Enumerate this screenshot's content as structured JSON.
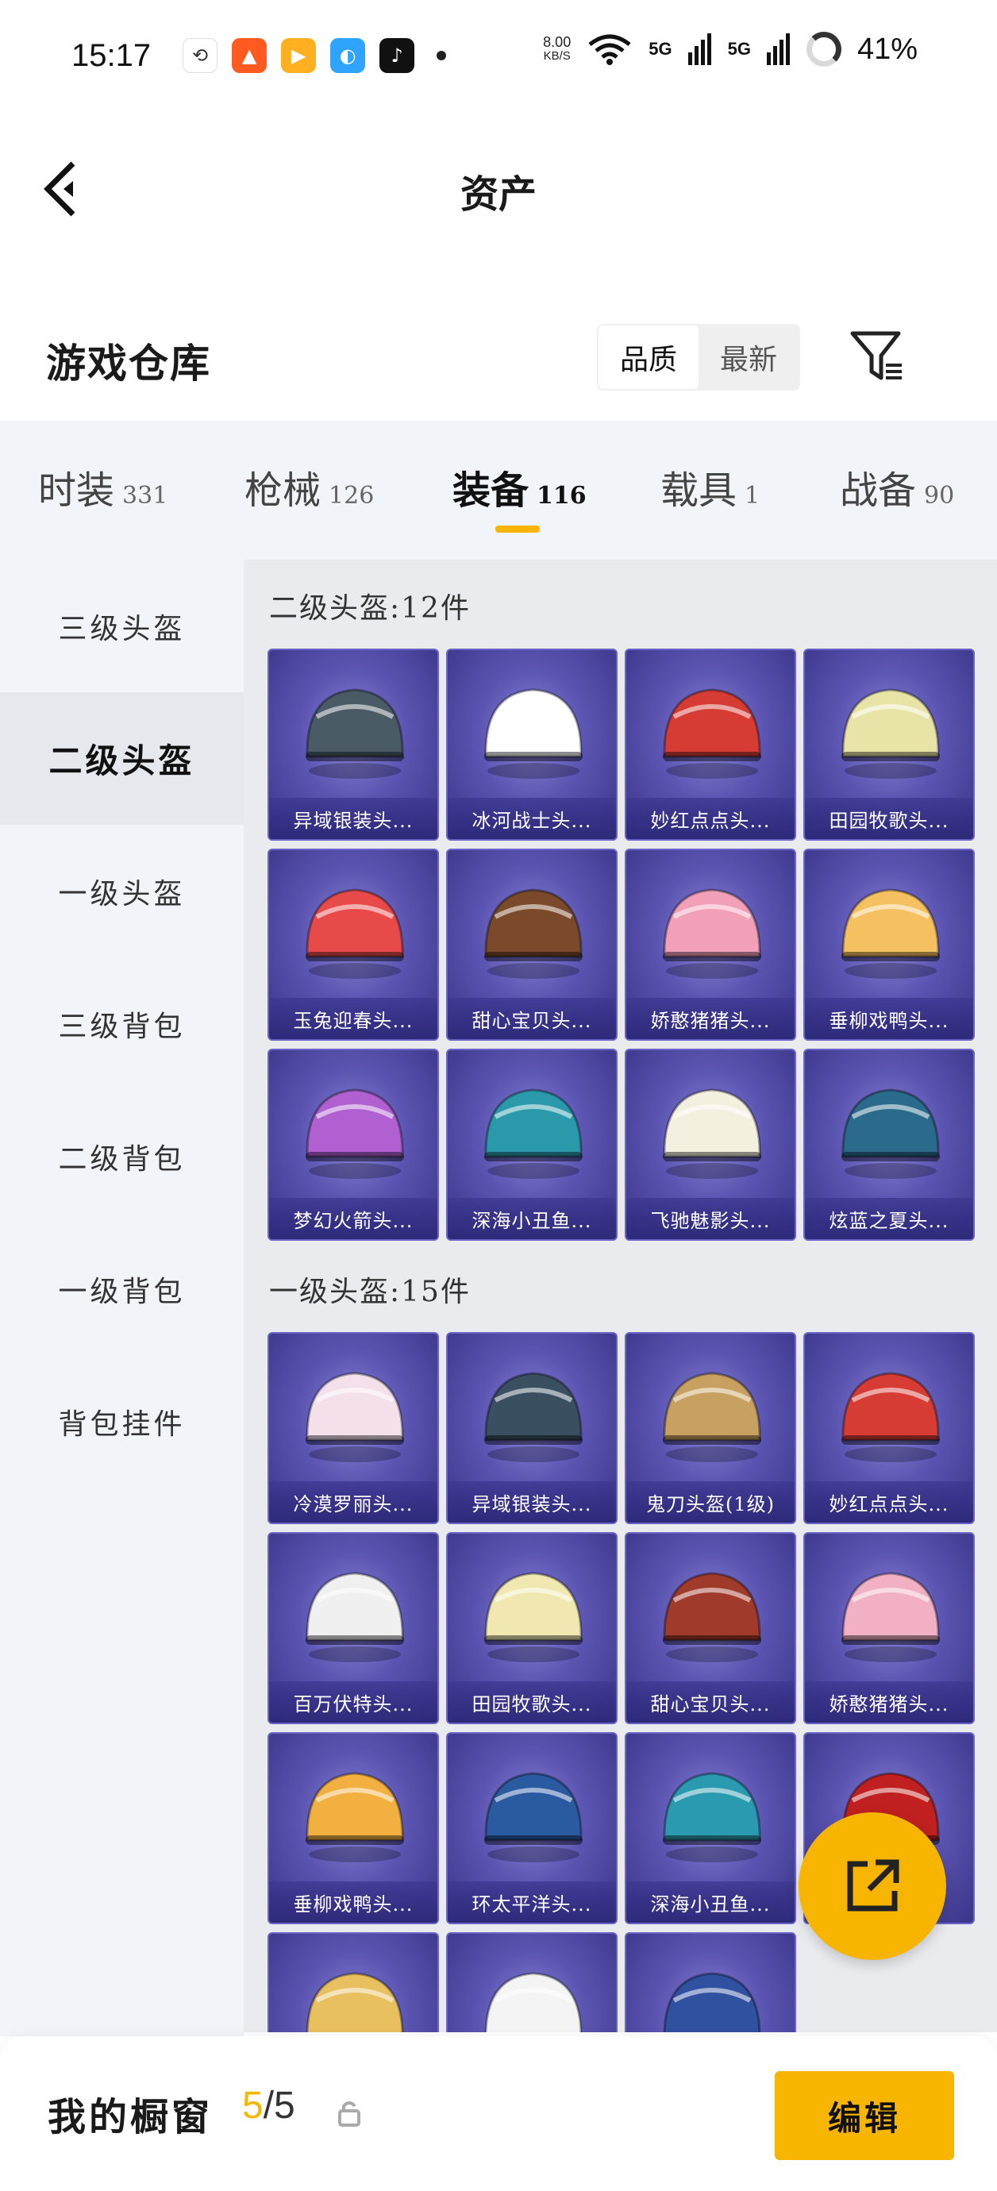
{
  "status_bar": {
    "time": "15:17",
    "app_icons": [
      "sync-icon",
      "rocket-app-icon",
      "video-app-icon",
      "browser-app-icon",
      "tiktok-icon"
    ],
    "net_speed_value": "8.00",
    "net_speed_unit": "KB/S",
    "signal1": "5G",
    "signal2": "5G",
    "battery": "41%"
  },
  "header": {
    "title": "资产",
    "back_icon": "chevron-left-icon"
  },
  "section": {
    "title": "游戏仓库",
    "sort_options": [
      "品质",
      "最新"
    ],
    "filter_icon": "filter-icon"
  },
  "tabs": [
    {
      "label": "时装",
      "count": "331"
    },
    {
      "label": "枪械",
      "count": "126"
    },
    {
      "label": "装备",
      "count": "116"
    },
    {
      "label": "载具",
      "count": "1"
    },
    {
      "label": "战备",
      "count": "90"
    }
  ],
  "sidebar": [
    "三级头盔",
    "二级头盔",
    "一级头盔",
    "三级背包",
    "二级背包",
    "一级背包",
    "背包挂件"
  ],
  "groups": [
    {
      "title": "二级头盔:12件",
      "items": [
        {
          "name": "异域银装头...",
          "color": "#4a5b66"
        },
        {
          "name": "冰河战士头...",
          "color": "#ffffff"
        },
        {
          "name": "妙红点点头...",
          "color": "#d63b34"
        },
        {
          "name": "田园牧歌头...",
          "color": "#e8e4a8"
        },
        {
          "name": "玉兔迎春头...",
          "color": "#e84a4a"
        },
        {
          "name": "甜心宝贝头...",
          "color": "#7a4a2a"
        },
        {
          "name": "娇憨猪猪头...",
          "color": "#f2a0b8"
        },
        {
          "name": "垂柳戏鸭头...",
          "color": "#f5c060"
        },
        {
          "name": "梦幻火箭头...",
          "color": "#b060d0"
        },
        {
          "name": "深海小丑鱼...",
          "color": "#2a9aaa"
        },
        {
          "name": "飞驰魅影头...",
          "color": "#f4f0e0"
        },
        {
          "name": "炫蓝之夏头...",
          "color": "#2a6a8a"
        }
      ]
    },
    {
      "title": "一级头盔:15件",
      "items": [
        {
          "name": "冷漠罗丽头...",
          "color": "#f4e0ea"
        },
        {
          "name": "异域银装头...",
          "color": "#3a5060"
        },
        {
          "name": "鬼刀头盔(1级)",
          "color": "#c8a060"
        },
        {
          "name": "妙红点点头...",
          "color": "#d63b34"
        },
        {
          "name": "百万伏特头...",
          "color": "#f0f0f0"
        },
        {
          "name": "田园牧歌头...",
          "color": "#f0e8b0"
        },
        {
          "name": "甜心宝贝头...",
          "color": "#a03a2a"
        },
        {
          "name": "娇憨猪猪头...",
          "color": "#f2b0c4"
        },
        {
          "name": "垂柳戏鸭头...",
          "color": "#f2b040"
        },
        {
          "name": "环太平洋头...",
          "color": "#2a5aa0"
        },
        {
          "name": "深海小丑鱼...",
          "color": "#2a9ab0"
        },
        {
          "name": "",
          "color": "#c02020"
        },
        {
          "name": "",
          "color": "#e8c060"
        },
        {
          "name": "",
          "color": "#f4f4f4"
        },
        {
          "name": "",
          "color": "#3050a0"
        }
      ]
    }
  ],
  "fab": {
    "icon": "share-external-icon"
  },
  "bottom": {
    "title": "我的橱窗",
    "current": "5",
    "total": "/5",
    "lock_icon": "lock-icon",
    "edit_label": "编辑"
  }
}
